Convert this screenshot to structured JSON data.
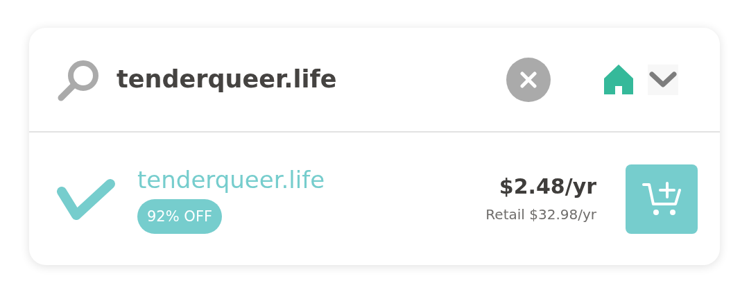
{
  "search": {
    "value": "tenderqueer.life"
  },
  "result": {
    "available": true,
    "domain": "tenderqueer.life",
    "discount": "92% OFF",
    "price": "$2.48/yr",
    "retail": "Retail $32.98/yr"
  }
}
